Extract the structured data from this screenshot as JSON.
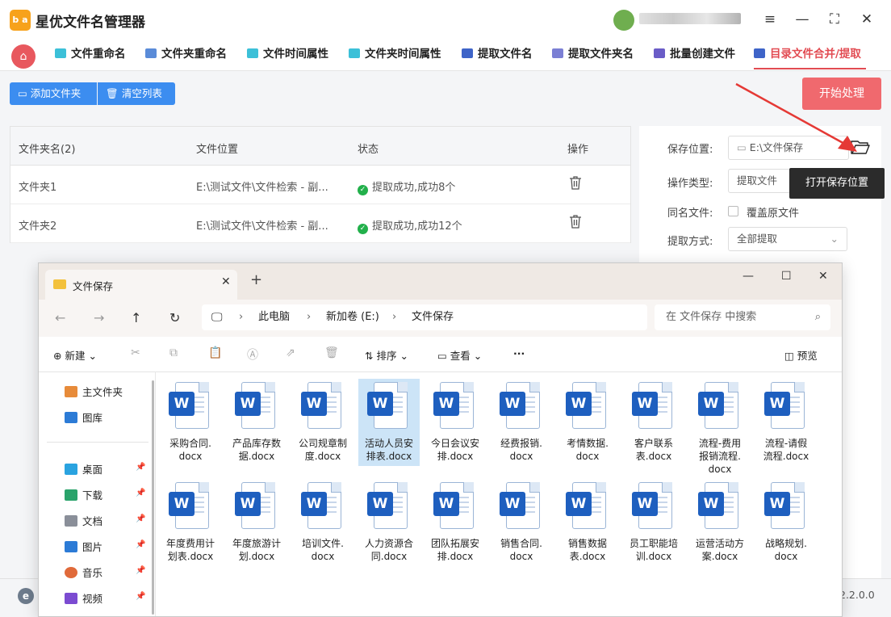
{
  "app": {
    "title": "星优文件名管理器",
    "logo_text": "b a",
    "version": "2.2.0.0"
  },
  "window_controls": {
    "settings": "≡",
    "minimize": "—",
    "maximize": "⛶",
    "close": "✕"
  },
  "tabs": [
    {
      "label": "文件重命名",
      "icon_color": "#3cc0d8"
    },
    {
      "label": "文件夹重命名",
      "icon_color": "#5a8bd8"
    },
    {
      "label": "文件时间属性",
      "icon_color": "#3cc0d8"
    },
    {
      "label": "文件夹时间属性",
      "icon_color": "#3cc0d8"
    },
    {
      "label": "提取文件名",
      "icon_color": "#3e64c8"
    },
    {
      "label": "提取文件夹名",
      "icon_color": "#7b7fd4"
    },
    {
      "label": "批量创建文件",
      "icon_color": "#6a5cc7"
    },
    {
      "label": "目录文件合并/提取",
      "icon_color": "#3e64c8"
    }
  ],
  "toolbar": {
    "add_folder": "添加文件夹",
    "clear_list": "清空列表",
    "start": "开始处理"
  },
  "table": {
    "headers": [
      "文件夹名(2)",
      "文件位置",
      "状态",
      "操作"
    ],
    "rows": [
      {
        "name": "文件夹1",
        "path": "E:\\测试文件\\文件检索 - 副...",
        "status": "提取成功,成功8个"
      },
      {
        "name": "文件夹2",
        "path": "E:\\测试文件\\文件检索 - 副...",
        "status": "提取成功,成功12个"
      }
    ]
  },
  "settings": {
    "save_location_label": "保存位置:",
    "save_location_value": "E:\\文件保存",
    "op_type_label": "操作类型:",
    "op_type_value": "提取文件",
    "same_name_label": "同名文件:",
    "overwrite_label": "覆盖原文件",
    "extract_mode_label": "提取方式:",
    "extract_mode_value": "全部提取",
    "tooltip": "打开保存位置"
  },
  "explorer": {
    "tab_title": "文件保存",
    "breadcrumb": [
      "此电脑",
      "新加卷 (E:)",
      "文件保存"
    ],
    "search_placeholder": "在 文件保存 中搜索",
    "commands": {
      "new": "新建",
      "sort": "排序",
      "view": "查看",
      "more": "···",
      "preview": "预览"
    },
    "sidebar": [
      {
        "label": "主文件夹",
        "color": "#e78b3a"
      },
      {
        "label": "图库",
        "color": "#2c7bd6"
      },
      {
        "label": "桌面",
        "color": "#2aa3e0",
        "pinned": true
      },
      {
        "label": "下载",
        "color": "#2aa36b",
        "pinned": true
      },
      {
        "label": "文档",
        "color": "#8a8f99",
        "pinned": true
      },
      {
        "label": "图片",
        "color": "#2c7bd6",
        "pinned": true
      },
      {
        "label": "音乐",
        "color": "#e06a3a",
        "pinned": true
      },
      {
        "label": "视频",
        "color": "#7b4bd1",
        "pinned": true
      }
    ],
    "files": [
      {
        "l1": "采购合同.",
        "l2": "docx"
      },
      {
        "l1": "产品库存数",
        "l2": "据.docx"
      },
      {
        "l1": "公司规章制",
        "l2": "度.docx"
      },
      {
        "l1": "活动人员安",
        "l2": "排表.docx",
        "selected": true
      },
      {
        "l1": "今日会议安",
        "l2": "排.docx"
      },
      {
        "l1": "经费报销.",
        "l2": "docx"
      },
      {
        "l1": "考情数据.",
        "l2": "docx"
      },
      {
        "l1": "客户联系",
        "l2": "表.docx"
      },
      {
        "l1": "流程-费用",
        "l2": "报销流程.",
        "l3": "docx"
      },
      {
        "l1": "流程-请假",
        "l2": "流程.docx"
      },
      {
        "l1": "年度费用计",
        "l2": "划表.docx"
      },
      {
        "l1": "年度旅游计",
        "l2": "划.docx"
      },
      {
        "l1": "培训文件.",
        "l2": "docx"
      },
      {
        "l1": "人力资源合",
        "l2": "同.docx"
      },
      {
        "l1": "团队拓展安",
        "l2": "排.docx"
      },
      {
        "l1": "销售合同.",
        "l2": "docx"
      },
      {
        "l1": "销售数据",
        "l2": "表.docx"
      },
      {
        "l1": "员工职能培",
        "l2": "训.docx"
      },
      {
        "l1": "运营活动方",
        "l2": "案.docx"
      },
      {
        "l1": "战略规划.",
        "l2": "docx"
      }
    ]
  }
}
